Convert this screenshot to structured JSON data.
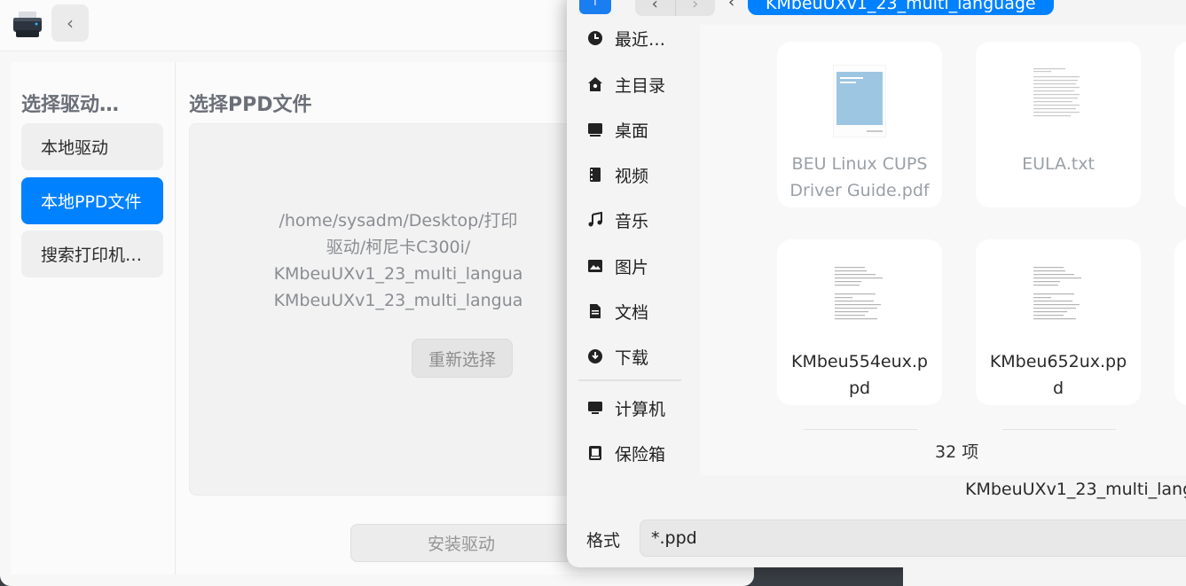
{
  "main_window": {
    "left_title": "选择驱动…",
    "nav": [
      {
        "label": "本地驱动",
        "active": false
      },
      {
        "label": "本地PPD文件",
        "active": true
      },
      {
        "label": "搜索打印机…",
        "active": false
      }
    ],
    "right_title": "选择PPD文件",
    "ppd_path_lines": [
      "/home/sysadm/Desktop/打印",
      "驱动/柯尼卡C300i/",
      "KMbeuUXv1_23_multi_langua",
      "KMbeuUXv1_23_multi_langua"
    ],
    "reselect_label": "重新选择",
    "install_label": "安装驱动",
    "accent_color": "#0081ff"
  },
  "file_dialog": {
    "breadcrumb_current": "KMbeuUXv1_23_multi_language",
    "sidebar": [
      {
        "label": "最近…",
        "icon": "clock-icon"
      },
      {
        "label": "主目录",
        "icon": "home-icon"
      },
      {
        "label": "桌面",
        "icon": "desktop-icon"
      },
      {
        "label": "视频",
        "icon": "video-icon"
      },
      {
        "label": "音乐",
        "icon": "music-icon"
      },
      {
        "label": "图片",
        "icon": "picture-icon"
      },
      {
        "label": "文档",
        "icon": "document-icon"
      },
      {
        "label": "下载",
        "icon": "download-icon"
      },
      {
        "label": "计算机",
        "icon": "computer-icon"
      },
      {
        "label": "保险箱",
        "icon": "vault-icon"
      }
    ],
    "files": [
      {
        "name_lines": [
          "BEU Linux CUPS",
          "Driver Guide.pdf"
        ],
        "kind": "pdf",
        "dimmed": true
      },
      {
        "name_lines": [
          "EULA.txt"
        ],
        "kind": "txt",
        "dimmed": true
      },
      {
        "name_lines": [
          "KMbeu554eux.p",
          "pd"
        ],
        "kind": "ppd",
        "dimmed": false
      },
      {
        "name_lines": [
          "KMbeu652ux.pp",
          "d"
        ],
        "kind": "ppd",
        "dimmed": false
      }
    ],
    "item_count": "32 项",
    "footer_path": "KMbeuUXv1_23_multi_lang",
    "format_label": "格式",
    "format_value": "*.ppd"
  }
}
